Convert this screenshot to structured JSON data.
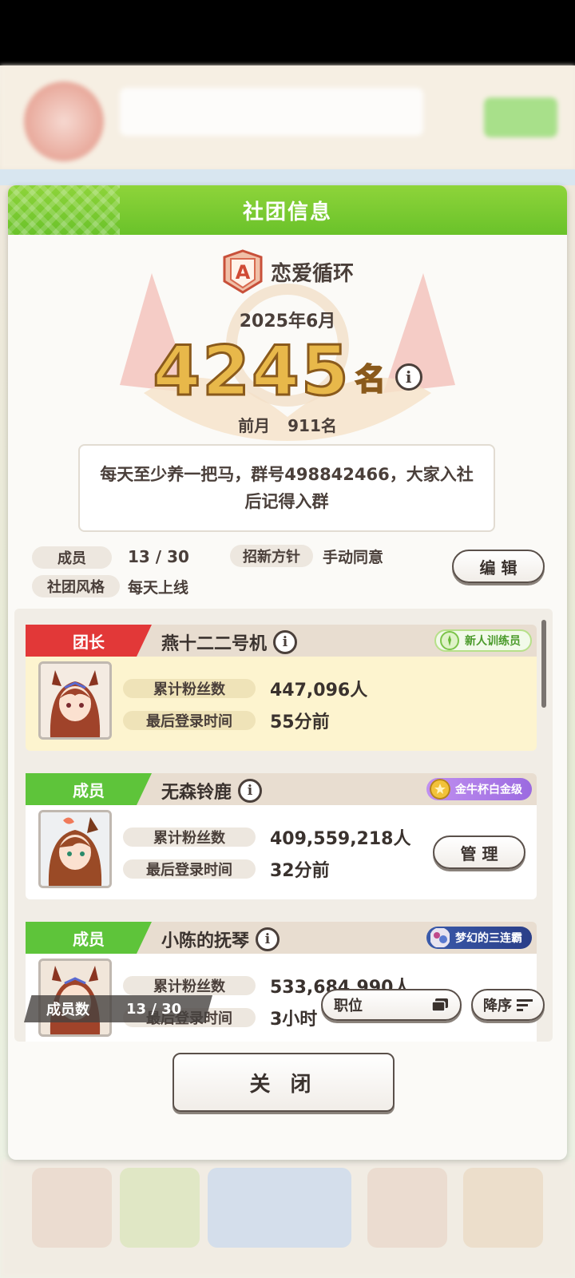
{
  "modal": {
    "title": "社团信息",
    "club_name": "恋爱循环",
    "period": "2025年6月",
    "rank_value": "4245",
    "rank_unit": "名",
    "prev_label": "前月",
    "prev_value": "911名",
    "description": "每天至少养一把马，群号498842466，大家入社后记得入群",
    "stats": {
      "members_label": "成员",
      "members_value": "13 / 30",
      "policy_label": "招新方针",
      "policy_value": "手动同意",
      "style_label": "社团风格",
      "style_value": "每天上线"
    },
    "edit_label": "编 辑",
    "close_label": "关 闭"
  },
  "members": [
    {
      "role": "团长",
      "name": "燕十二二号机",
      "badge": "新人训练员",
      "fans_label": "累计粉丝数",
      "fans_value": "447,096人",
      "login_label": "最后登录时间",
      "login_value": "55分前"
    },
    {
      "role": "成员",
      "name": "无森铃鹿",
      "badge": "金牛杯白金级",
      "fans_label": "累计粉丝数",
      "fans_value": "409,559,218人",
      "login_label": "最后登录时间",
      "login_value": "32分前",
      "manage_label": "管 理"
    },
    {
      "role": "成员",
      "name": "小陈的抚琴",
      "badge": "梦幻的三连霸",
      "fans_label": "累计粉丝数",
      "fans_value": "533,684,990人",
      "login_label": "最后登录时间",
      "login_value": "3小时"
    }
  ],
  "list_footer": {
    "count_label": "成员数",
    "count_value": "13 / 30",
    "sort_field": "职位",
    "sort_order": "降序"
  },
  "colors": {
    "header_green": "#6ac22a",
    "leader_red": "#e23838",
    "member_green": "#5ec43a",
    "rank_gold": "#e8b84a"
  }
}
